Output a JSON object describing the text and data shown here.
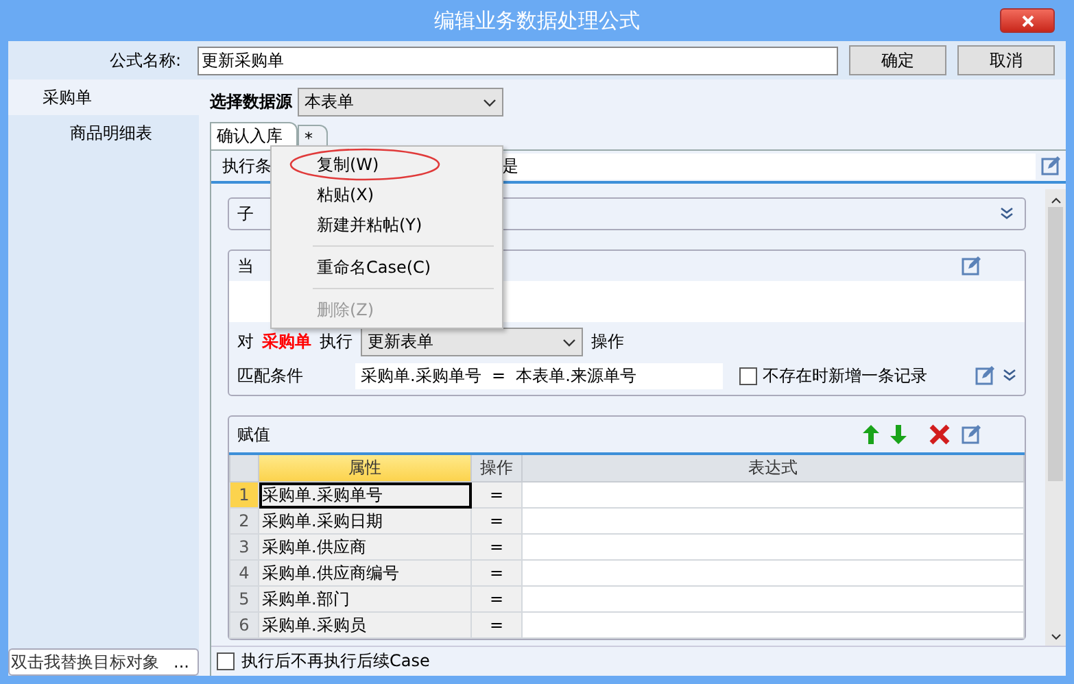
{
  "window": {
    "title": "编辑业务数据处理公式"
  },
  "formula": {
    "label": "公式名称:",
    "value": "更新采购单"
  },
  "buttons": [
    "确定",
    "取消"
  ],
  "sidebar": {
    "items": [
      {
        "label": "采购单",
        "selected": true
      },
      {
        "label": "商品明细表",
        "selected": false
      }
    ],
    "footer": {
      "value": "双击我替换目标对象",
      "button": "..."
    }
  },
  "datasource": {
    "label": "选择数据源",
    "value": "本表单"
  },
  "tabs": [
    {
      "label": "确认入库",
      "selected": true
    },
    {
      "label": "*",
      "selected": false
    }
  ],
  "condition": {
    "label": "执行条",
    "value": "是"
  },
  "subsection": {
    "label": "子"
  },
  "current": {
    "label": "当",
    "prefix": "对",
    "target": "采购单",
    "action_label": "执行",
    "action_value": "更新表单",
    "suffix": "操作",
    "match_label": "匹配条件",
    "match_value": "采购单.采购单号  =  本表单.来源单号",
    "create_if_missing": {
      "label": "不存在时新增一条记录",
      "checked": false
    }
  },
  "assign": {
    "title": "赋值",
    "columns": [
      {
        "label": "属性",
        "selected": true
      },
      {
        "label": "操作",
        "selected": false
      },
      {
        "label": "表达式",
        "selected": false
      }
    ],
    "rows": [
      {
        "index": "1",
        "property": "采购单.采购单号",
        "op": "=",
        "selected": true
      },
      {
        "index": "2",
        "property": "采购单.采购日期",
        "op": "=",
        "selected": false
      },
      {
        "index": "3",
        "property": "采购单.供应商",
        "op": "=",
        "selected": false
      },
      {
        "index": "4",
        "property": "采购单.供应商编号",
        "op": "=",
        "selected": false
      },
      {
        "index": "5",
        "property": "采购单.部门",
        "op": "=",
        "selected": false
      },
      {
        "index": "6",
        "property": "采购单.采购员",
        "op": "=",
        "selected": false
      }
    ]
  },
  "stop_after": {
    "label": "执行后不再执行后续Case",
    "checked": false
  },
  "context_menu": {
    "items": [
      {
        "kind": "item",
        "label": "复制(W)",
        "disabled": false,
        "circled": true
      },
      {
        "kind": "item",
        "label": "粘贴(X)",
        "disabled": false,
        "circled": false
      },
      {
        "kind": "item",
        "label": "新建并粘帖(Y)",
        "disabled": false,
        "circled": false
      },
      {
        "kind": "separator"
      },
      {
        "kind": "item",
        "label": "重命名Case(C)",
        "disabled": false,
        "circled": false
      },
      {
        "kind": "separator"
      },
      {
        "kind": "item",
        "label": "删除(Z)",
        "disabled": true,
        "circled": false
      }
    ]
  }
}
